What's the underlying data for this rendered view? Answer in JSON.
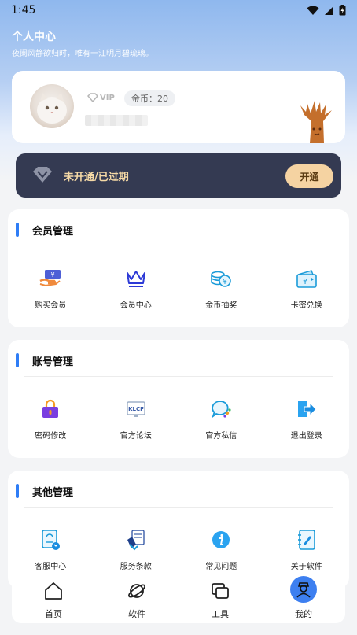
{
  "status_bar": {
    "time": "1:45"
  },
  "header": {
    "title": "个人中心",
    "subtitle": "夜阑风静欲归时，唯有一江明月碧琉璃。"
  },
  "profile": {
    "vip_label": "VIP",
    "coins": "金币：20"
  },
  "vip_banner": {
    "status": "未开通/已过期",
    "button": "开通"
  },
  "sections": [
    {
      "title": "会员管理",
      "items": [
        {
          "label": "购买会员",
          "icon": "buy-vip-icon"
        },
        {
          "label": "会员中心",
          "icon": "crown-icon"
        },
        {
          "label": "金币抽奖",
          "icon": "coin-lottery-icon"
        },
        {
          "label": "卡密兑换",
          "icon": "card-redeem-icon"
        }
      ]
    },
    {
      "title": "账号管理",
      "items": [
        {
          "label": "密码修改",
          "icon": "lock-icon"
        },
        {
          "label": "官方论坛",
          "icon": "forum-icon"
        },
        {
          "label": "官方私信",
          "icon": "message-icon"
        },
        {
          "label": "退出登录",
          "icon": "logout-icon"
        }
      ]
    },
    {
      "title": "其他管理",
      "items": [
        {
          "label": "客服中心",
          "icon": "customer-service-icon"
        },
        {
          "label": "服务条款",
          "icon": "terms-icon"
        },
        {
          "label": "常见问题",
          "icon": "info-icon"
        },
        {
          "label": "关于软件",
          "icon": "about-icon"
        }
      ]
    }
  ],
  "bottom_nav": [
    {
      "label": "首页",
      "icon": "home-icon"
    },
    {
      "label": "软件",
      "icon": "planet-icon"
    },
    {
      "label": "工具",
      "icon": "tools-icon"
    },
    {
      "label": "我的",
      "icon": "profile-icon",
      "active": true
    }
  ],
  "colors": {
    "accent": "#2e7df6",
    "banner_bg": "#343a52",
    "vip_gold": "#f5d3a2"
  }
}
